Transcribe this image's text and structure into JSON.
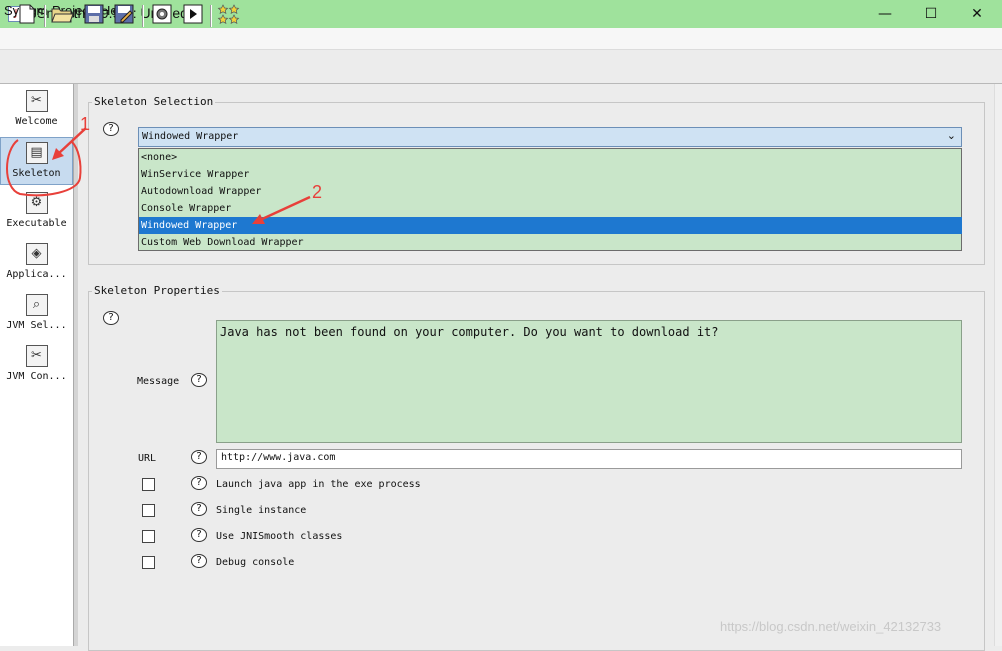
{
  "window": {
    "title": "JSmooth 0.9.9-7: Untitled",
    "app_icon_glyph": "J",
    "controls": {
      "minimize": "—",
      "maximize": "☐",
      "close": "✕"
    }
  },
  "menu": [
    "System",
    "Project",
    "Help"
  ],
  "toolbar": {
    "icons": [
      "new-file-icon",
      "open-folder-icon",
      "save-icon",
      "save-as-icon",
      "compile-icon",
      "run-icon",
      "stars-icon"
    ]
  },
  "sidebar": {
    "items": [
      {
        "label": "Welcome",
        "icon": "✂"
      },
      {
        "label": "Skeleton",
        "icon": "▤"
      },
      {
        "label": "Executable",
        "icon": "⚙"
      },
      {
        "label": "Applica...",
        "icon": "◈"
      },
      {
        "label": "JVM Sel...",
        "icon": "⌕"
      },
      {
        "label": "JVM Con...",
        "icon": "✂"
      }
    ],
    "active_index": 1
  },
  "skeleton_selection": {
    "title": "Skeleton Selection",
    "combo_value": "Windowed Wrapper",
    "options": [
      "<none>",
      "WinService Wrapper",
      "Autodownload Wrapper",
      "Console Wrapper",
      "Windowed Wrapper",
      "Custom Web Download Wrapper"
    ],
    "selected_index": 4
  },
  "skeleton_properties": {
    "title": "Skeleton Properties",
    "message_label": "Message",
    "message_value": "Java has not been found on your computer. Do you want to download it?",
    "url_label": "URL",
    "url_value": "http://www.java.com",
    "checkboxes": [
      {
        "label": "Launch java app in the exe process",
        "checked": false
      },
      {
        "label": "Single instance",
        "checked": false
      },
      {
        "label": "Use JNISmooth classes",
        "checked": false
      },
      {
        "label": "Debug console",
        "checked": false
      }
    ]
  },
  "help_glyph": "?",
  "annotations": {
    "one": "1",
    "two": "2",
    "color": "#e8403a"
  },
  "watermark": "https://blog.csdn.net/weixin_42132733",
  "colors": {
    "title_bar": "#9fe29c",
    "field_green": "#c9e6c9",
    "selection_blue": "#1e78d0",
    "combo_blue": "#cfe2f3"
  }
}
